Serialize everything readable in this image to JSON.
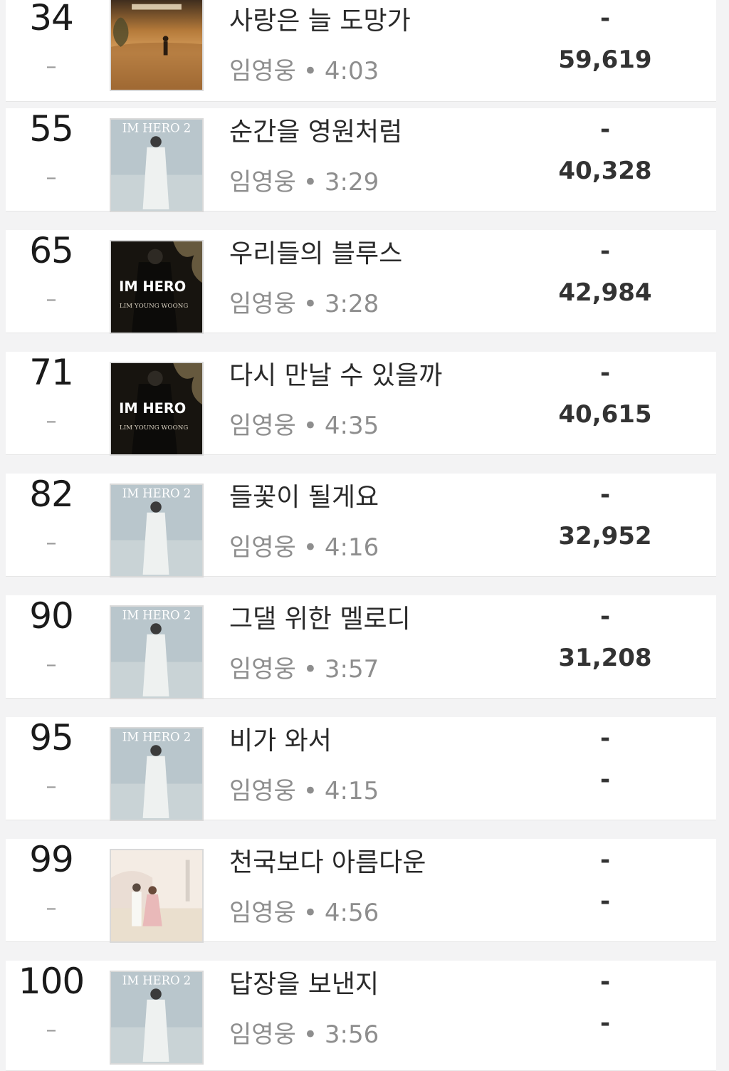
{
  "rows": [
    {
      "rank": "34",
      "change": "–",
      "title": "사랑은 늘 도망가",
      "artist": "임영웅",
      "sep": "•",
      "duration": "4:03",
      "stat_top": "-",
      "stat_bottom": "59,619",
      "cover_style": "sunset"
    },
    {
      "rank": "55",
      "change": "–",
      "title": "순간을 영원처럼",
      "artist": "임영웅",
      "sep": "•",
      "duration": "3:29",
      "stat_top": "-",
      "stat_bottom": "40,328",
      "cover_style": "hero2"
    },
    {
      "rank": "65",
      "change": "–",
      "title": "우리들의 블루스",
      "artist": "임영웅",
      "sep": "•",
      "duration": "3:28",
      "stat_top": "-",
      "stat_bottom": "42,984",
      "cover_style": "hero1"
    },
    {
      "rank": "71",
      "change": "–",
      "title": "다시 만날 수 있을까",
      "artist": "임영웅",
      "sep": "•",
      "duration": "4:35",
      "stat_top": "-",
      "stat_bottom": "40,615",
      "cover_style": "hero1"
    },
    {
      "rank": "82",
      "change": "–",
      "title": "들꽃이 될게요",
      "artist": "임영웅",
      "sep": "•",
      "duration": "4:16",
      "stat_top": "-",
      "stat_bottom": "32,952",
      "cover_style": "hero2"
    },
    {
      "rank": "90",
      "change": "–",
      "title": "그댈 위한 멜로디",
      "artist": "임영웅",
      "sep": "•",
      "duration": "3:57",
      "stat_top": "-",
      "stat_bottom": "31,208",
      "cover_style": "hero2"
    },
    {
      "rank": "95",
      "change": "–",
      "title": "비가 와서",
      "artist": "임영웅",
      "sep": "•",
      "duration": "4:15",
      "stat_top": "-",
      "stat_bottom": "-",
      "cover_style": "hero2"
    },
    {
      "rank": "99",
      "change": "–",
      "title": "천국보다 아름다운",
      "artist": "임영웅",
      "sep": "•",
      "duration": "4:56",
      "stat_top": "-",
      "stat_bottom": "-",
      "cover_style": "beach"
    },
    {
      "rank": "100",
      "change": "–",
      "title": "답장을 보낸지",
      "artist": "임영웅",
      "sep": "•",
      "duration": "3:56",
      "stat_top": "-",
      "stat_bottom": "-",
      "cover_style": "hero2"
    }
  ],
  "cover_text": {
    "hero1": "IM HERO",
    "hero1_sub": "LIM YOUNG WOONG",
    "hero2": "IM HERO 2"
  },
  "colors": {
    "background": "#f3f3f4",
    "row": "#ffffff",
    "rank": "#1a1a1a",
    "muted": "#8e8e8e",
    "stat": "#333333"
  }
}
